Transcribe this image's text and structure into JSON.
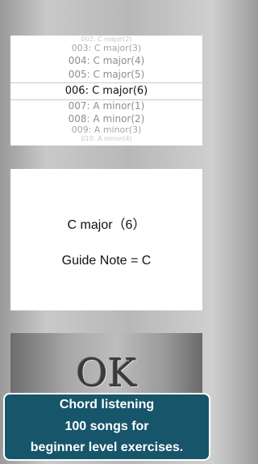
{
  "picker": {
    "items": [
      "002: C major(2)",
      "003: C major(3)",
      "004: C major(4)",
      "005: C major(5)",
      "006: C major(6)",
      "007: A minor(1)",
      "008: A minor(2)",
      "009: A minor(3)",
      "010: A minor(4)"
    ],
    "selected_index": 4
  },
  "info": {
    "chord_name": "C major（6）",
    "guide_note": "Guide Note = C"
  },
  "ok_button": {
    "label": "OK"
  },
  "promo": {
    "line1": "Chord listening",
    "line2": "100 songs for",
    "line3": "beginner level exercises."
  }
}
